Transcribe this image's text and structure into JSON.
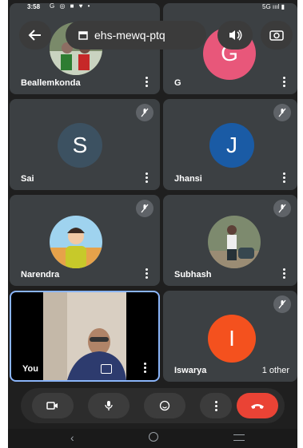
{
  "status_bar": {
    "time": "3:58",
    "left_icons": "G ◎ ■ ♥ •",
    "right_icons": "5G ıııl ▮"
  },
  "header": {
    "meeting_code": "ehs-mewq-ptq"
  },
  "participants": [
    {
      "name": "Beallemkonda",
      "muted": false
    },
    {
      "name": "G",
      "initial": "G",
      "avatar_color": "#e8577a",
      "muted": false
    },
    {
      "name": "Sai",
      "initial": "S",
      "avatar_color": "#3c5161",
      "muted": true
    },
    {
      "name": "Jhansi",
      "initial": "J",
      "avatar_color": "#1a5ba5",
      "muted": true
    },
    {
      "name": "Narendra",
      "muted": true
    },
    {
      "name": "Subhash",
      "muted": true
    },
    {
      "name": "You",
      "muted": false
    },
    {
      "name": "Iswarya",
      "initial": "I",
      "avatar_color": "#f4511e",
      "muted": true
    }
  ],
  "others_label": "1 other",
  "colors": {
    "active_border": "#8ab4f8",
    "end_call": "#ea4335",
    "tile": "#3c4043"
  }
}
